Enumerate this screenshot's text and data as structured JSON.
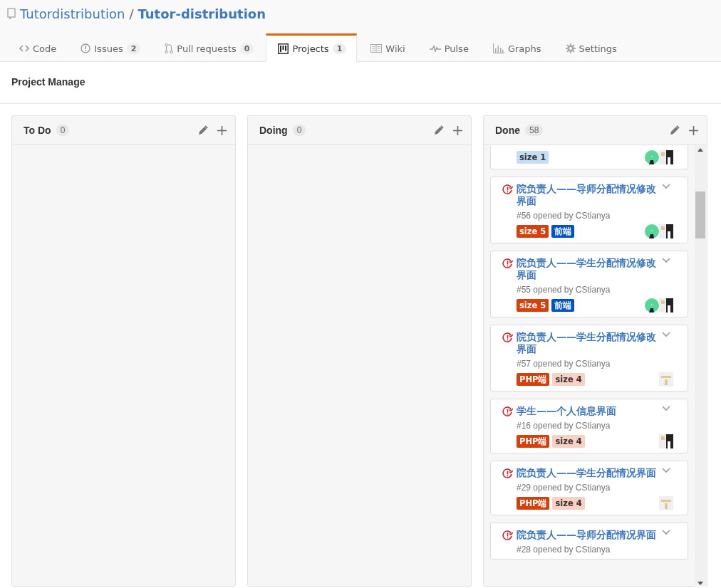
{
  "repo": {
    "owner": "Tutordistribution",
    "separator": "/",
    "name": "Tutor-distribution"
  },
  "tabs": [
    {
      "kind": "code",
      "label": "Code",
      "selected": false
    },
    {
      "kind": "issues",
      "label": "Issues",
      "count": "2",
      "selected": false
    },
    {
      "kind": "pulls",
      "label": "Pull requests",
      "count": "0",
      "selected": false
    },
    {
      "kind": "projects",
      "label": "Projects",
      "count": "1",
      "selected": true
    },
    {
      "kind": "wiki",
      "label": "Wiki",
      "selected": false
    },
    {
      "kind": "pulse",
      "label": "Pulse",
      "selected": false
    },
    {
      "kind": "graphs",
      "label": "Graphs",
      "selected": false
    },
    {
      "kind": "settings",
      "label": "Settings",
      "selected": false
    }
  ],
  "project": {
    "title": "Project Manage"
  },
  "columns": [
    {
      "name": "To Do",
      "count": "0"
    },
    {
      "name": "Doing",
      "count": "0"
    },
    {
      "name": "Done",
      "count": "58",
      "cards": [
        {
          "labels": [
            {
              "text": "size 1",
              "color": "#c5def5"
            }
          ],
          "avatars": [
            {
              "kind": "circle"
            },
            {
              "kind": "square"
            }
          ]
        },
        {
          "title": "院负责人——导师分配情况修改界面",
          "meta": "#56 opened by CStianya",
          "labels": [
            {
              "text": "size 5",
              "color": "#d93f0b"
            },
            {
              "text": "前端",
              "color": "#0052cc"
            }
          ],
          "avatars": [
            {
              "kind": "circle"
            },
            {
              "kind": "square"
            }
          ]
        },
        {
          "title": "院负责人——学生分配情况修改界面",
          "meta": "#55 opened by CStianya",
          "labels": [
            {
              "text": "size 5",
              "color": "#d93f0b"
            },
            {
              "text": "前端",
              "color": "#0052cc"
            }
          ],
          "avatars": [
            {
              "kind": "circle"
            },
            {
              "kind": "square"
            }
          ]
        },
        {
          "title": "院负责人——学生分配情况修改界面",
          "meta": "#57 opened by CStianya",
          "labels": [
            {
              "text": "PHP端",
              "color": "#d93f0b"
            },
            {
              "text": "size 4",
              "color": "#f9d0c4"
            }
          ],
          "avatars": [
            {
              "kind": "pixel"
            }
          ]
        },
        {
          "title": "学生——个人信息界面",
          "meta": "#16 opened by CStianya",
          "labels": [
            {
              "text": "PHP端",
              "color": "#d93f0b"
            },
            {
              "text": "size 4",
              "color": "#f9d0c4"
            }
          ],
          "avatars": [
            {
              "kind": "square"
            }
          ]
        },
        {
          "title": "院负责人——学生分配情况界面",
          "meta": "#29 opened by CStianya",
          "labels": [
            {
              "text": "PHP端",
              "color": "#d93f0b"
            },
            {
              "text": "size 4",
              "color": "#f9d0c4"
            }
          ],
          "avatars": [
            {
              "kind": "pixel"
            }
          ]
        },
        {
          "title": "院负责人——导师分配情况界面",
          "meta": "#28 opened by CStianya"
        }
      ]
    }
  ]
}
